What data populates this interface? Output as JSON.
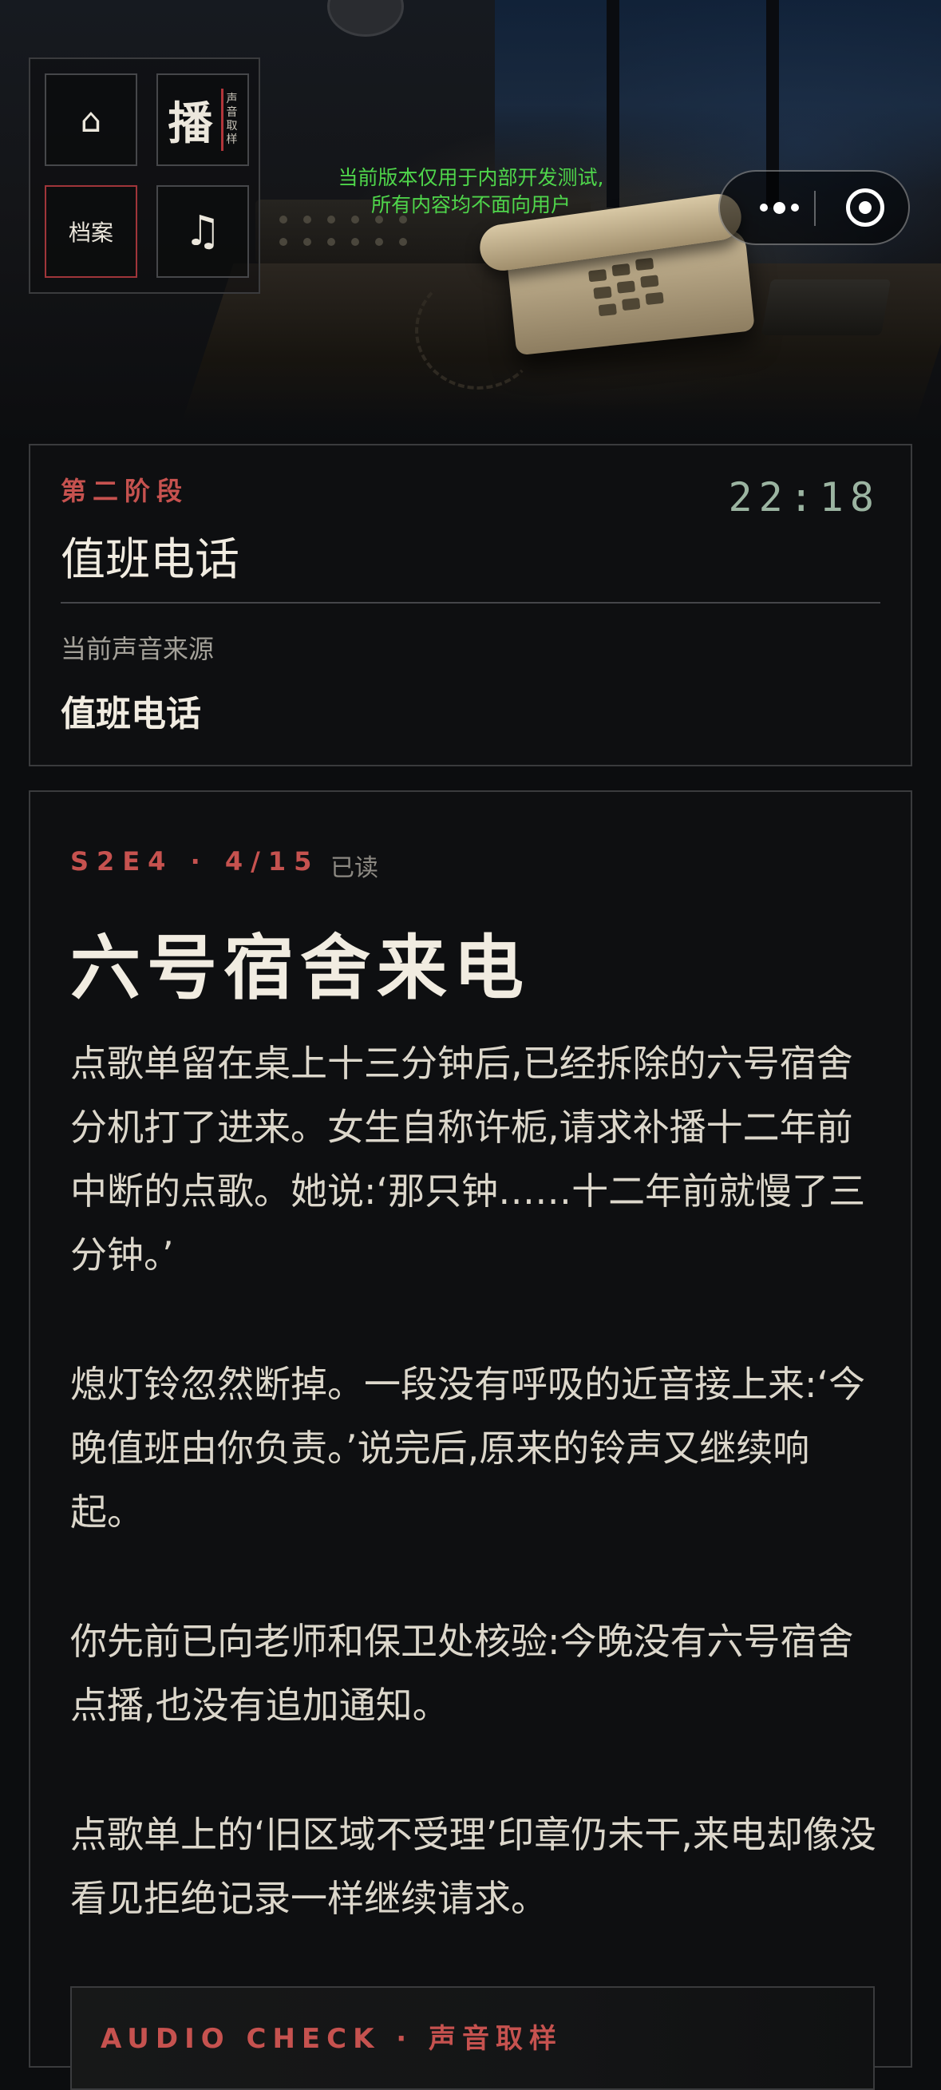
{
  "nav": {
    "home_icon": "⌂",
    "play_glyph": "播",
    "play_tag": "声音取样",
    "archive_label": "档案",
    "music_icon": "♫"
  },
  "notice": {
    "line1": "当前版本仅用于内部开发测试,",
    "line2": "所有内容均不面向用户"
  },
  "capsule": {
    "more_icon": "more-dots-icon",
    "close_icon": "target-circle-icon"
  },
  "stage": {
    "label": "第二阶段",
    "title": "值班电话",
    "time": "22:18",
    "source_label": "当前声音来源",
    "source_value": "值班电话"
  },
  "story": {
    "episode": "S2E4 · 4/15",
    "read_status": "已读",
    "title": "六号宿舍来电",
    "paragraphs": [
      "点歌单留在桌上十三分钟后,已经拆除的六号宿舍分机打了进来。女生自称许栀,请求补播十二年前中断的点歌。她说:‘那只钟……十二年前就慢了三分钟。’",
      "熄灯铃忽然断掉。一段没有呼吸的近音接上来:‘今晚值班由你负责。’说完后,原来的铃声又继续响起。",
      "你先前已向老师和保卫处核验:今晚没有六号宿舍点播,也没有追加通知。",
      "点歌单上的‘旧区域不受理’印章仍未干,来电却像没看见拒绝记录一样继续请求。"
    ],
    "audio_check": "AUDIO CHECK · 声音取样"
  },
  "colors": {
    "accent_red": "#c6524f",
    "notice_green": "#4fd64b",
    "clock_green": "#9bb4a1",
    "background": "#0c0d0f"
  }
}
